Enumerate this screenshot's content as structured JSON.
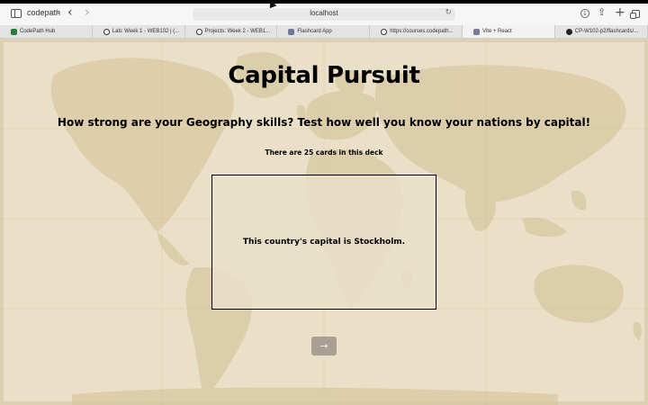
{
  "browser": {
    "profile_name": "codepath",
    "address": "localhost",
    "tabs": [
      {
        "label": "CodePath Hub",
        "favicon_color": "#2b7a3d",
        "favicon": "C"
      },
      {
        "label": "Lab: Week 1 - WEB102 | (...",
        "favicon_color": "#333333",
        "favicon": "C"
      },
      {
        "label": "Projects: Week 2 - WEB1...",
        "favicon_color": "#333333",
        "favicon": "C"
      },
      {
        "label": "Flashcard App",
        "favicon_color": "#6d7a99",
        "favicon": "F"
      },
      {
        "label": "https://courses.codepath...",
        "favicon_color": "#333333",
        "favicon": "C"
      },
      {
        "label": "Vite + React",
        "favicon_color": "#7a7a9a",
        "favicon": "L",
        "active": true
      },
      {
        "label": "CP-W102-p2/flashcards/...",
        "favicon_color": "#222222",
        "favicon": "G"
      }
    ]
  },
  "app": {
    "title": "Capital Pursuit",
    "subtitle": "How strong are your Geography skills? Test how well you know your nations by capital!",
    "card_count_text": "There are 25 cards in this deck",
    "card_text": "This country's capital is Stockholm.",
    "next_label": "→"
  },
  "colors": {
    "background": "#e9dfc7",
    "land": "#d8c7a0",
    "card_border": "#000000",
    "button_bg": "#a8a095"
  }
}
